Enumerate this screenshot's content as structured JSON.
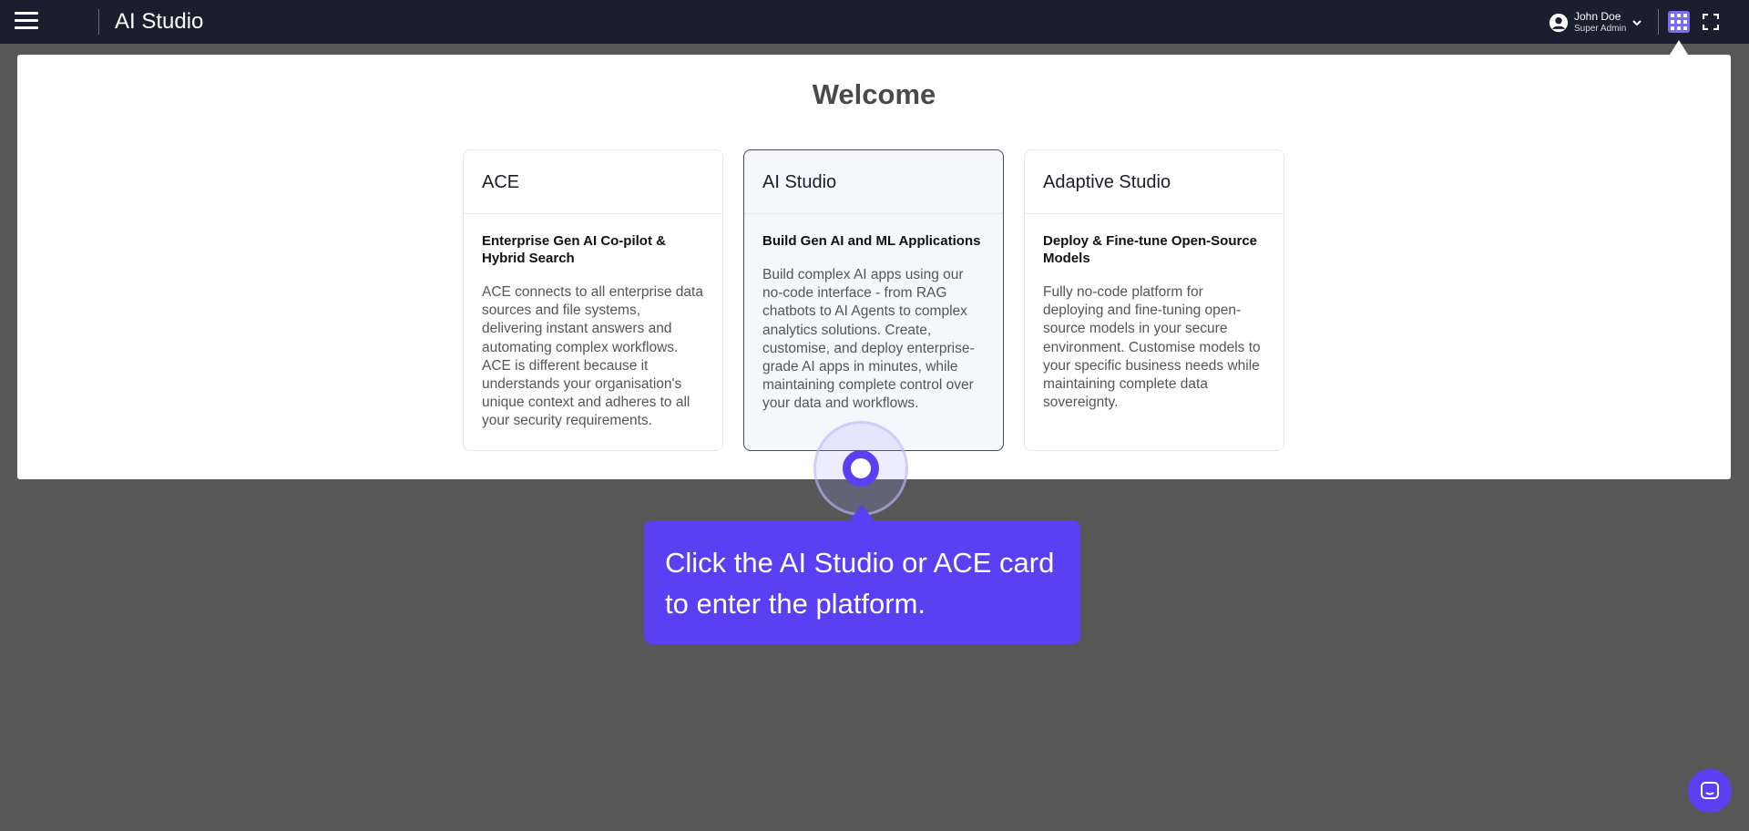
{
  "header": {
    "app_title": "AI Studio",
    "menu_icon": "hamburger-menu-icon",
    "user": {
      "name": "John Doe",
      "role": "Super Admin"
    },
    "apps_icon": "grid-apps-icon",
    "fullscreen_icon": "fullscreen-icon"
  },
  "main": {
    "heading": "Welcome",
    "cards": [
      {
        "title": "ACE",
        "subtitle": "Enterprise Gen AI Co-pilot & Hybrid Search",
        "description": "ACE connects to all enterprise data sources and file systems, delivering instant answers and automating complex workflows. ACE is different because it understands your organisation's unique context and adheres to all your security requirements."
      },
      {
        "title": "AI Studio",
        "subtitle": "Build Gen AI and ML Applications",
        "description": "Build complex AI apps using our no-code interface - from RAG chatbots to AI Agents to complex analytics solutions. Create, customise, and deploy enterprise-grade AI apps in minutes, while maintaining complete control over your data and workflows."
      },
      {
        "title": "Adaptive Studio",
        "subtitle": "Deploy & Fine-tune Open-Source Models",
        "description": "Fully no-code platform for deploying and fine-tuning open-source models in your secure environment. Customise models to your specific business needs while maintaining complete data sovereignty."
      }
    ]
  },
  "tooltip": {
    "text": "Click the AI Studio or ACE card to enter the platform."
  },
  "colors": {
    "accent": "#5b3ff2",
    "topbar": "#1b1e2e",
    "overlay": "#575757"
  }
}
